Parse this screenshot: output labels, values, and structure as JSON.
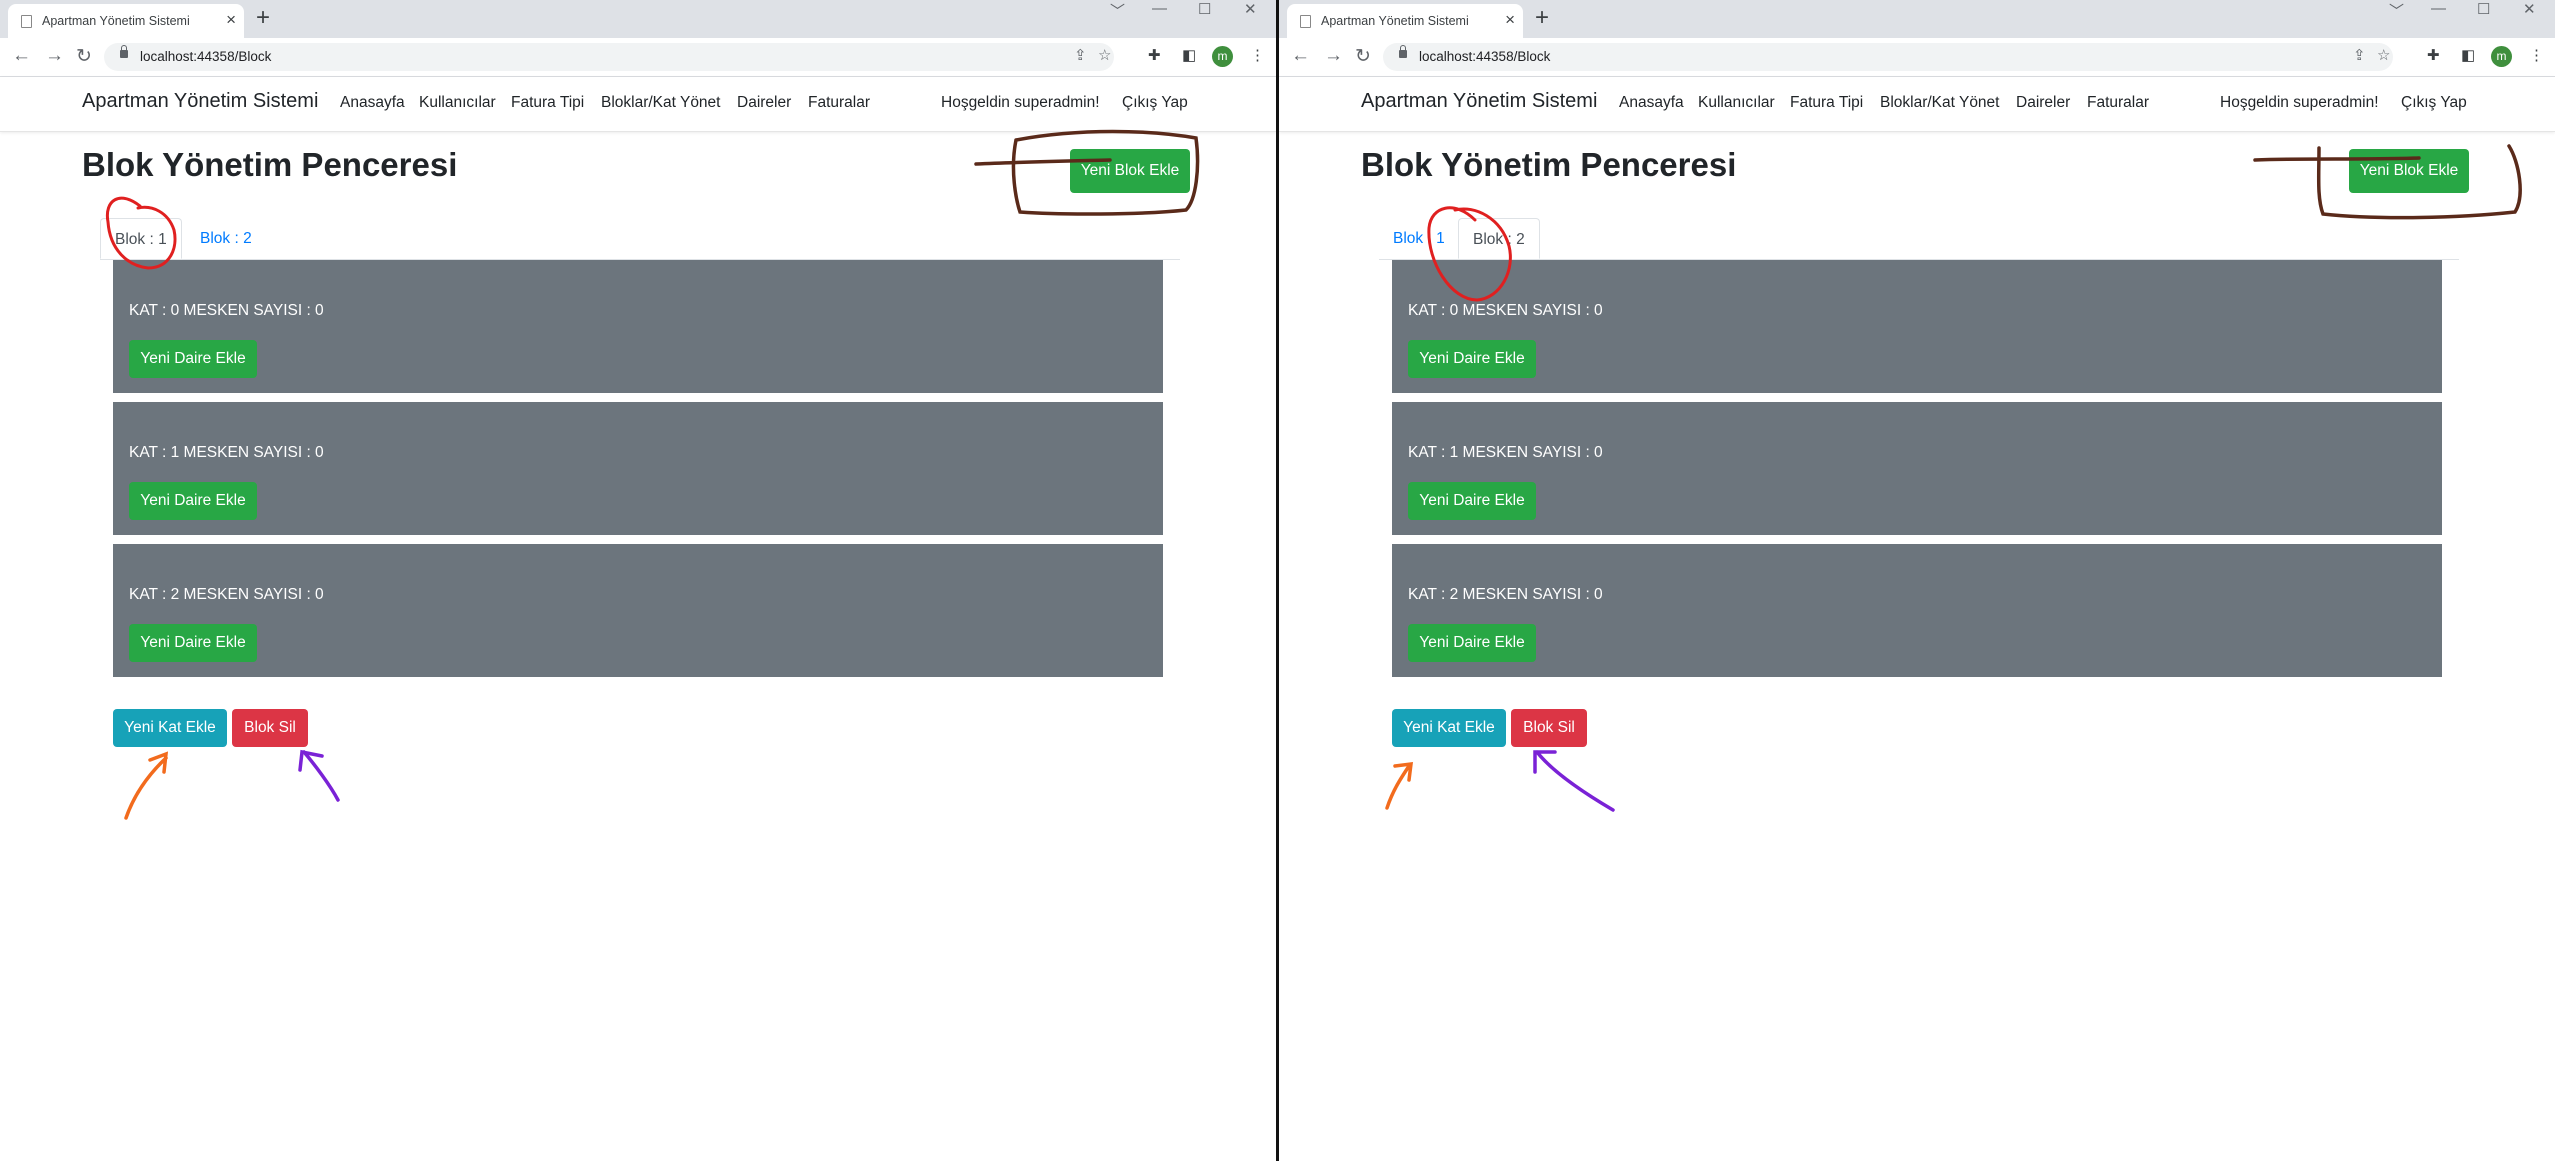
{
  "browser": {
    "tab_title": "Apartman Yönetim Sistemi",
    "tab_close": "×",
    "new_tab": "+",
    "url": "localhost:44358/Block",
    "profile_initial": "m",
    "window_controls": [
      "﹀",
      "—",
      "☐",
      "✕"
    ],
    "nav_icons": [
      "back-arrow-icon",
      "forward-arrow-icon",
      "reload-icon"
    ]
  },
  "app": {
    "brand": "Apartman Yönetim Sistemi",
    "nav_links": [
      "Anasayfa",
      "Kullanıcılar",
      "Fatura Tipi",
      "Bloklar/Kat Yönet",
      "Daireler",
      "Faturalar"
    ],
    "greeting": "Hoşgeldin superadmin!",
    "logout": "Çıkış Yap"
  },
  "page": {
    "heading": "Blok Yönetim Penceresi",
    "add_block_button": "Yeni Blok Ekle",
    "tabs": [
      "Blok : 1",
      "Blok : 2"
    ],
    "floors": [
      {
        "text": "KAT : 0 MESKEN SAYISI : 0",
        "button": "Yeni Daire Ekle"
      },
      {
        "text": "KAT : 1 MESKEN SAYISI : 0",
        "button": "Yeni Daire Ekle"
      },
      {
        "text": "KAT : 2 MESKEN SAYISI : 0",
        "button": "Yeni Daire Ekle"
      }
    ],
    "add_floor_button": "Yeni Kat Ekle",
    "delete_block_button": "Blok Sil"
  },
  "windows": [
    {
      "active_tab_index": 0
    },
    {
      "active_tab_index": 1
    }
  ],
  "colors": {
    "success": "#28a745",
    "info": "#17a2b8",
    "danger": "#dc3545",
    "floor_bg": "#6c757d",
    "annotation_red": "#e02020",
    "annotation_brown": "#5a2a1a",
    "annotation_orange": "#f26b1d",
    "annotation_purple": "#7a22d6"
  }
}
